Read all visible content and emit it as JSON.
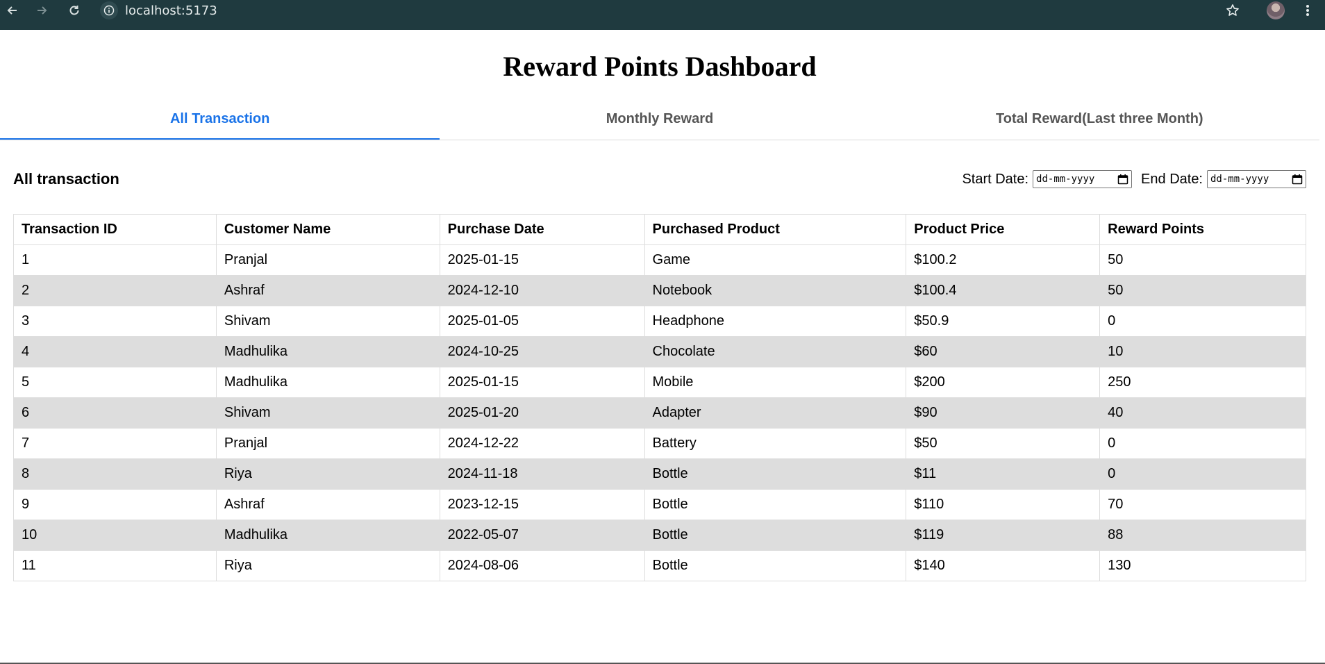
{
  "browser": {
    "url": "localhost:5173"
  },
  "page": {
    "title": "Reward Points Dashboard"
  },
  "tabs": [
    {
      "label": "All Transaction",
      "active": true
    },
    {
      "label": "Monthly Reward",
      "active": false
    },
    {
      "label": "Total Reward(Last three Month)",
      "active": false
    }
  ],
  "section": {
    "title": "All transaction",
    "start_label": "Start Date:",
    "end_label": "End Date:",
    "start_placeholder": "dd-mm-yyyy",
    "end_placeholder": "dd-mm-yyyy"
  },
  "table": {
    "headers": [
      "Transaction ID",
      "Customer Name",
      "Purchase Date",
      "Purchased Product",
      "Product Price",
      "Reward Points"
    ],
    "rows": [
      [
        "1",
        "Pranjal",
        "2025-01-15",
        "Game",
        "$100.2",
        "50"
      ],
      [
        "2",
        "Ashraf",
        "2024-12-10",
        "Notebook",
        "$100.4",
        "50"
      ],
      [
        "3",
        "Shivam",
        "2025-01-05",
        "Headphone",
        "$50.9",
        "0"
      ],
      [
        "4",
        "Madhulika",
        "2024-10-25",
        "Chocolate",
        "$60",
        "10"
      ],
      [
        "5",
        "Madhulika",
        "2025-01-15",
        "Mobile",
        "$200",
        "250"
      ],
      [
        "6",
        "Shivam",
        "2025-01-20",
        "Adapter",
        "$90",
        "40"
      ],
      [
        "7",
        "Pranjal",
        "2024-12-22",
        "Battery",
        "$50",
        "0"
      ],
      [
        "8",
        "Riya",
        "2024-11-18",
        "Bottle",
        "$11",
        "0"
      ],
      [
        "9",
        "Ashraf",
        "2023-12-15",
        "Bottle",
        "$110",
        "70"
      ],
      [
        "10",
        "Madhulika",
        "2022-05-07",
        "Bottle",
        "$119",
        "88"
      ],
      [
        "11",
        "Riya",
        "2024-08-06",
        "Bottle",
        "$140",
        "130"
      ]
    ]
  },
  "colors": {
    "chrome_bg": "#1f3a3f",
    "accent": "#1a73e8",
    "row_stripe": "#dddddd"
  }
}
